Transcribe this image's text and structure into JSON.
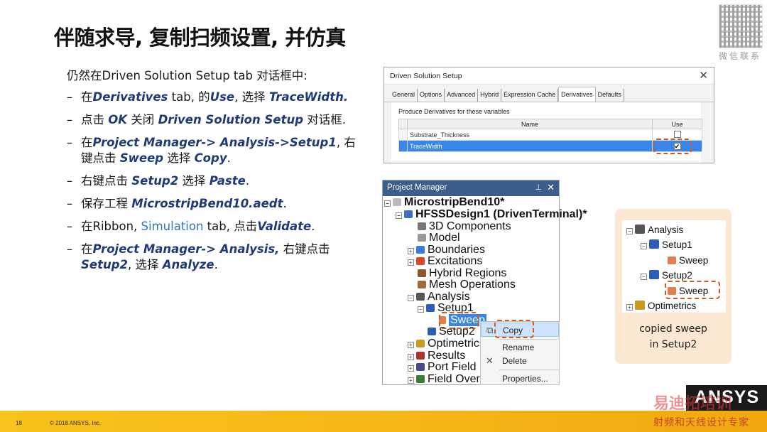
{
  "slide": {
    "title": "伴随求导, 复制扫频设置, 并仿真",
    "qr_caption": "微信联系",
    "intro": "仍然在Driven Solution Setup tab 对话框中:",
    "bullets": [
      {
        "p1": "在",
        "e1": "Derivatives",
        "p2": " tab, 的",
        "e2": "Use",
        "p3": ", 选择 ",
        "e3": "TraceWidth."
      },
      {
        "p1": "点击 ",
        "e1": "OK",
        "p2": " 关闭 ",
        "e2": "Driven Solution Setup",
        "p3": " 对话框."
      },
      {
        "p1": "在",
        "e1": "Project Manager-> Analysis->Setup1",
        "p2": ", 右键点击 ",
        "e2": "Sweep",
        "p3": " 选择 ",
        "e3": "Copy",
        "p4": "."
      },
      {
        "p1": "右键点击 ",
        "e1": "Setup2",
        "p2": " 选择 ",
        "e2": "Paste",
        "p3": "."
      },
      {
        "p1": "保存工程 ",
        "e1": "MicrostripBend10.aedt",
        "p2": "."
      },
      {
        "p1": "在Ribbon, ",
        "link": "Simulation",
        "p2": " tab, 点击",
        "e1": "Validate",
        "p3": "."
      },
      {
        "p1": "在",
        "e1": "Project Manager-> Analysis,",
        "p2": " 右键点击 ",
        "e2": "Setup2",
        "p3": ", 选择 ",
        "e3": "Analyze",
        "p4": "."
      }
    ]
  },
  "dialog": {
    "title": "Driven Solution Setup",
    "close": "✕",
    "tabs": [
      "General",
      "Options",
      "Advanced",
      "Hybrid",
      "Expression Cache",
      "Derivatives",
      "Defaults"
    ],
    "active_tab": "Derivatives",
    "produce_label": "Produce Derivatives for these variables",
    "columns": [
      "Name",
      "Use"
    ],
    "rows": [
      {
        "name": "Substrate_Thickness",
        "use": false
      },
      {
        "name": "TraceWidth",
        "use": true
      }
    ]
  },
  "project_manager": {
    "title": "Project Manager",
    "pin": "ᵖ",
    "close": "✕",
    "nodes": {
      "project": "MicrostripBend10*",
      "design": "HFSSDesign1 (DrivenTerminal)*",
      "components": "3D Components",
      "model": "Model",
      "boundaries": "Boundaries",
      "excitations": "Excitations",
      "hybrid": "Hybrid Regions",
      "mesh": "Mesh Operations",
      "analysis": "Analysis",
      "setup1": "Setup1",
      "sweep": "Sweep",
      "setup2": "Setup2",
      "optimetrics": "Optimetrics",
      "results": "Results",
      "portfield": "Port Field Displ",
      "overlays": "Field Overlays"
    }
  },
  "context_menu": {
    "copy": "Copy",
    "rename": "Rename",
    "delete": "Delete",
    "properties": "Properties..."
  },
  "callout": {
    "analysis": "Analysis",
    "setup1": "Setup1",
    "sweep1": "Sweep",
    "setup2": "Setup2",
    "sweep2": "Sweep",
    "optimetrics": "Optimetrics",
    "caption_line1": "copied sweep",
    "caption_line2": "in Setup2"
  },
  "footer": {
    "page_number": "18",
    "copyright": "© 2018 ANSYS, Inc.",
    "logo": "ANSYS",
    "watermark": "易迪拓培训",
    "watermark_sub": "射频和天线设计专家"
  },
  "colors": {
    "accent_blue": "#1f3a78",
    "link_blue": "#2e75c5",
    "highlight_orange": "#d2581d",
    "selection_blue": "#3a86e8",
    "footer_gold": "#f5b515"
  }
}
